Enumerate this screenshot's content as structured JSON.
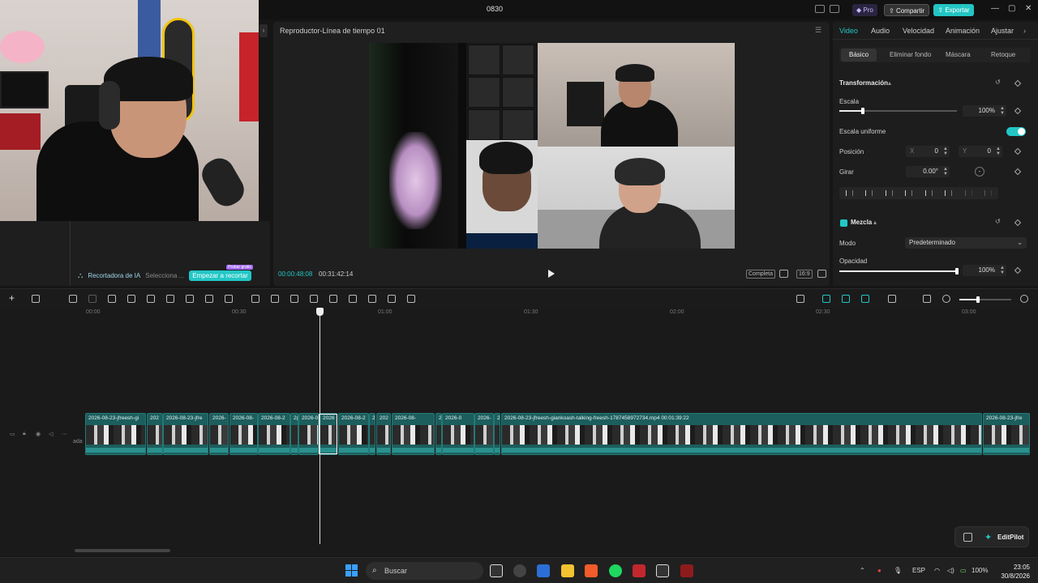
{
  "window": {
    "title": "0830",
    "pro_label": "Pro",
    "share_label": "Compartir",
    "export_label": "Exportar"
  },
  "ai_cropper": {
    "label": "Recortadora de IA",
    "select_text": "Selecciona ...",
    "button_label": "Empezar a recortar",
    "badge": "Probar gratis"
  },
  "player": {
    "title": "Reproductor-Línea de tiempo 01",
    "current_time": "00:00:48:08",
    "total_time": "00:31:42:14",
    "quality": "Completa",
    "ratio": "16:9"
  },
  "properties": {
    "tabs": [
      "Video",
      "Audio",
      "Velocidad",
      "Animación",
      "Ajustar"
    ],
    "active_tab": "Video",
    "subtabs": [
      "Básico",
      "Eliminar fondo",
      "Máscara",
      "Retoque"
    ],
    "active_subtab": "Básico",
    "transform_header": "Transformación",
    "scale_label": "Escala",
    "scale_value": "100%",
    "scale_fraction": 0.2,
    "uniform_scale_label": "Escala uniforme",
    "uniform_scale_on": true,
    "position_label": "Posición",
    "pos_x_label": "X",
    "pos_x": "0",
    "pos_y_label": "Y",
    "pos_y": "0",
    "rotate_label": "Girar",
    "rotate_value": "0.00°",
    "rotate_dash": "-",
    "blend_header": "Mezcla",
    "mode_label": "Modo",
    "mode_value": "Predeterminado",
    "opacity_label": "Opacidad",
    "opacity_value": "100%",
    "opacity_fraction": 1.0
  },
  "timeline": {
    "ruler": [
      "00:00",
      "00:30",
      "01:00",
      "01:30",
      "02:00",
      "02:30",
      "03:00"
    ],
    "track_label": "ada",
    "clips": [
      {
        "label": "2026-08-23-jfreesh-gi"
      },
      {
        "label": "202"
      },
      {
        "label": "2026-08-23-jfre"
      },
      {
        "label": "2026-"
      },
      {
        "label": "2026-08-"
      },
      {
        "label": "2026-08-2"
      },
      {
        "label": "2("
      },
      {
        "label": "2026-0"
      },
      {
        "label": "2026"
      },
      {
        "label": "2026-08-2"
      },
      {
        "label": "2i"
      },
      {
        "label": "202"
      },
      {
        "label": "2026-08-"
      },
      {
        "label": "2("
      },
      {
        "label": "2026-0"
      },
      {
        "label": "2026-"
      },
      {
        "label": "2("
      },
      {
        "label": "2026-08-23-jfreesh-giankoash-talking-freesh-1787458972734.mp4  00:01:39:22"
      },
      {
        "label": "2026-08-23-jfre"
      }
    ]
  },
  "editpilot": {
    "label": "EditPilot"
  },
  "taskbar": {
    "search_placeholder": "Buscar",
    "lang": "ESP",
    "battery": "100%",
    "time": "23:05",
    "date": "30/8/2026"
  },
  "colors": {
    "accent": "#22c7c5",
    "clip": "#1c5e5d",
    "badge": "#a56bff"
  }
}
